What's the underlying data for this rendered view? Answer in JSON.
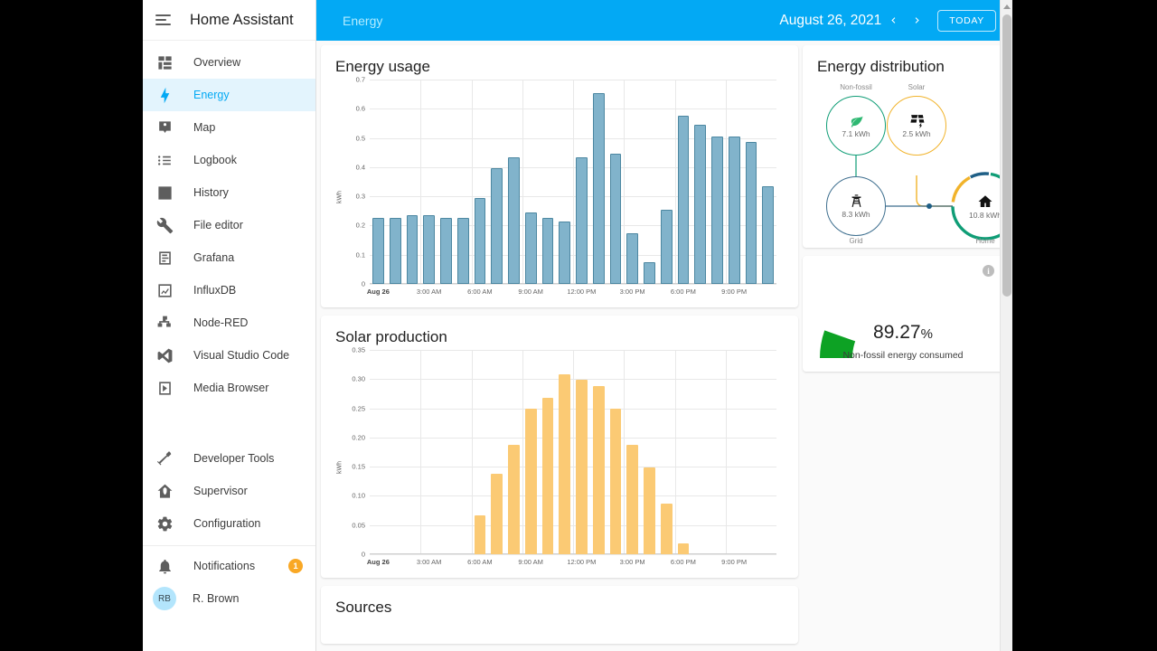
{
  "app": {
    "title": "Home Assistant",
    "menu_icon": "menu-collapse-icon"
  },
  "topbar": {
    "tab_label": "Energy",
    "date": "August 26, 2021",
    "prev_icon": "chevron-left-icon",
    "next_icon": "chevron-right-icon",
    "today_label": "TODAY",
    "accent": "#03a9f4"
  },
  "sidebar": {
    "items": [
      {
        "label": "Overview",
        "icon": "view-dashboard-icon",
        "active": false
      },
      {
        "label": "Energy",
        "icon": "lightning-bolt-icon",
        "active": true
      },
      {
        "label": "Map",
        "icon": "map-marker-account-icon",
        "active": false
      },
      {
        "label": "Logbook",
        "icon": "format-list-bulleted-icon",
        "active": false
      },
      {
        "label": "History",
        "icon": "chart-box-icon",
        "active": false
      },
      {
        "label": "File editor",
        "icon": "wrench-icon",
        "active": false
      },
      {
        "label": "Grafana",
        "icon": "grafana-icon",
        "active": false
      },
      {
        "label": "InfluxDB",
        "icon": "chart-line-icon",
        "active": false
      },
      {
        "label": "Node-RED",
        "icon": "sitemap-icon",
        "active": false
      },
      {
        "label": "Visual Studio Code",
        "icon": "vscode-icon",
        "active": false
      },
      {
        "label": "Media Browser",
        "icon": "play-box-icon",
        "active": false
      }
    ],
    "lower_items": [
      {
        "label": "Developer Tools",
        "icon": "hammer-icon"
      },
      {
        "label": "Supervisor",
        "icon": "home-shield-icon"
      },
      {
        "label": "Configuration",
        "icon": "cog-icon"
      }
    ],
    "notifications": {
      "label": "Notifications",
      "icon": "bell-icon",
      "count": "1",
      "badge_color": "#f9a825"
    },
    "user": {
      "label": "R. Brown",
      "initials": "RB",
      "avatar_color": "#b3e5fc"
    }
  },
  "cards": {
    "energy_usage_title": "Energy usage",
    "solar_title": "Solar production",
    "sources_title": "Sources",
    "distribution_title": "Energy distribution"
  },
  "distribution": {
    "nodes": [
      {
        "key": "nonfossil",
        "label": "Non-fossil",
        "value": "7.1 kWh",
        "icon": "leaf-icon",
        "color": "#0f9d76"
      },
      {
        "key": "solar",
        "label": "Solar",
        "value": "2.5 kWh",
        "icon": "solar-power-icon",
        "color": "#f1b32b"
      },
      {
        "key": "grid",
        "label": "Grid",
        "value": "8.3 kWh",
        "icon": "transmission-tower-icon",
        "color": "#3d6e8e"
      },
      {
        "key": "home",
        "label": "Home",
        "value": "10.8 kWh",
        "icon": "home-icon",
        "color": "#0f9d76"
      }
    ],
    "home_ring": {
      "green_pct": 72,
      "orange_pct": 18,
      "blue_pct": 10
    }
  },
  "gauge": {
    "value": "89.27",
    "unit": "%",
    "caption": "Non-fossil energy consumed",
    "color": "#0da224",
    "percent": 89.27,
    "info_icon": "info-icon"
  },
  "chart_data": [
    {
      "id": "energy_usage",
      "type": "bar",
      "title": "Energy usage",
      "ylabel": "kWh",
      "xlabel": "",
      "ylim": [
        0,
        0.7
      ],
      "yticks": [
        0,
        0.1,
        0.2,
        0.3,
        0.4,
        0.5,
        0.6,
        0.7
      ],
      "ytick_labels": [
        "0",
        "0.1",
        "0.2",
        "0.3",
        "0.4",
        "0.5",
        "0.6",
        "0.7"
      ],
      "xtick_labels": [
        "Aug 26",
        "3:00 AM",
        "6:00 AM",
        "9:00 AM",
        "12:00 PM",
        "3:00 PM",
        "6:00 PM",
        "9:00 PM"
      ],
      "xtick_hours": [
        0,
        3,
        6,
        9,
        12,
        15,
        18,
        21
      ],
      "grid": true,
      "color": "#81b3cb",
      "border_color": "#4c87a1",
      "hours": [
        0,
        1,
        2,
        3,
        4,
        5,
        6,
        7,
        8,
        9,
        10,
        11,
        12,
        13,
        14,
        15,
        16,
        17,
        18,
        19,
        20,
        21,
        22,
        23
      ],
      "values": [
        0.225,
        0.225,
        0.235,
        0.235,
        0.225,
        0.225,
        0.295,
        0.395,
        0.435,
        0.245,
        0.225,
        0.215,
        0.435,
        0.655,
        0.445,
        0.175,
        0.075,
        0.255,
        0.575,
        0.545,
        0.505,
        0.505,
        0.485,
        0.335
      ]
    },
    {
      "id": "solar_production",
      "type": "bar",
      "title": "Solar production",
      "ylabel": "kWh",
      "xlabel": "",
      "ylim": [
        0,
        0.35
      ],
      "yticks": [
        0,
        0.05,
        0.1,
        0.15,
        0.2,
        0.25,
        0.3,
        0.35
      ],
      "ytick_labels": [
        "0",
        "0.05",
        "0.10",
        "0.15",
        "0.20",
        "0.25",
        "0.30",
        "0.35"
      ],
      "xtick_labels": [
        "Aug 26",
        "3:00 AM",
        "6:00 AM",
        "9:00 AM",
        "12:00 PM",
        "3:00 PM",
        "6:00 PM",
        "9:00 PM"
      ],
      "xtick_hours": [
        0,
        3,
        6,
        9,
        12,
        15,
        18,
        21
      ],
      "grid": true,
      "color": "#fbca74",
      "border_color": "#fbca74",
      "hours": [
        0,
        1,
        2,
        3,
        4,
        5,
        6,
        7,
        8,
        9,
        10,
        11,
        12,
        13,
        14,
        15,
        16,
        17,
        18,
        19,
        20,
        21,
        22,
        23
      ],
      "values": [
        0,
        0,
        0,
        0,
        0,
        0,
        0.067,
        0.138,
        0.188,
        0.249,
        0.268,
        0.308,
        0.299,
        0.288,
        0.249,
        0.188,
        0.149,
        0.087,
        0.018,
        0,
        0,
        0,
        0,
        0
      ]
    }
  ]
}
